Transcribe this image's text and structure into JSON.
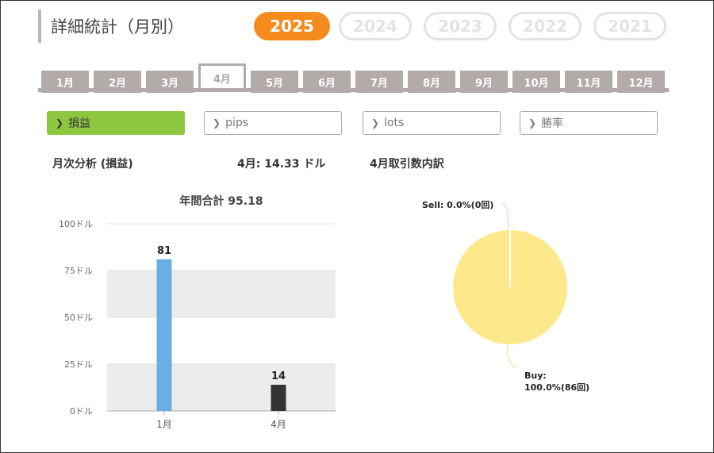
{
  "page": {
    "title": "詳細統計（月別）"
  },
  "years": [
    {
      "label": "2025",
      "active": true
    },
    {
      "label": "2024",
      "active": false
    },
    {
      "label": "2023",
      "active": false
    },
    {
      "label": "2022",
      "active": false
    },
    {
      "label": "2021",
      "active": false
    }
  ],
  "months": [
    "1月",
    "2月",
    "3月",
    "4月",
    "5月",
    "6月",
    "7月",
    "8月",
    "9月",
    "10月",
    "11月",
    "12月"
  ],
  "selected_month": "4月",
  "metrics": [
    {
      "label": "損益",
      "active": true
    },
    {
      "label": "pips",
      "active": false
    },
    {
      "label": "lots",
      "active": false
    },
    {
      "label": "勝率",
      "active": false
    }
  ],
  "summary": {
    "section_label": "月次分析 (損益)",
    "month_value": "4月:  14.33 ドル",
    "breakdown_label": "4月取引数内訳"
  },
  "colors": {
    "accent": "#f68b1e",
    "active_metric": "#8dc63f",
    "bar_jan": "#6aaee6",
    "bar_apr": "#333333",
    "pie_buy": "#fde98c"
  },
  "chart_data": [
    {
      "type": "bar",
      "title": "年間合計 95.18",
      "categories": [
        "1月",
        "4月"
      ],
      "values": [
        81,
        14
      ],
      "data_labels": [
        "81",
        "14"
      ],
      "yticks": [
        "0ドル",
        "25ドル",
        "50ドル",
        "75ドル",
        "100ドル"
      ],
      "ylim": [
        0,
        100
      ],
      "grid": true
    },
    {
      "type": "pie",
      "slices": [
        {
          "name": "Sell",
          "label": "Sell: 0.0%(0回)",
          "value": 0
        },
        {
          "name": "Buy",
          "label_line1": "Buy:",
          "label_line2": "100.0%(86回)",
          "value": 100
        }
      ]
    }
  ]
}
